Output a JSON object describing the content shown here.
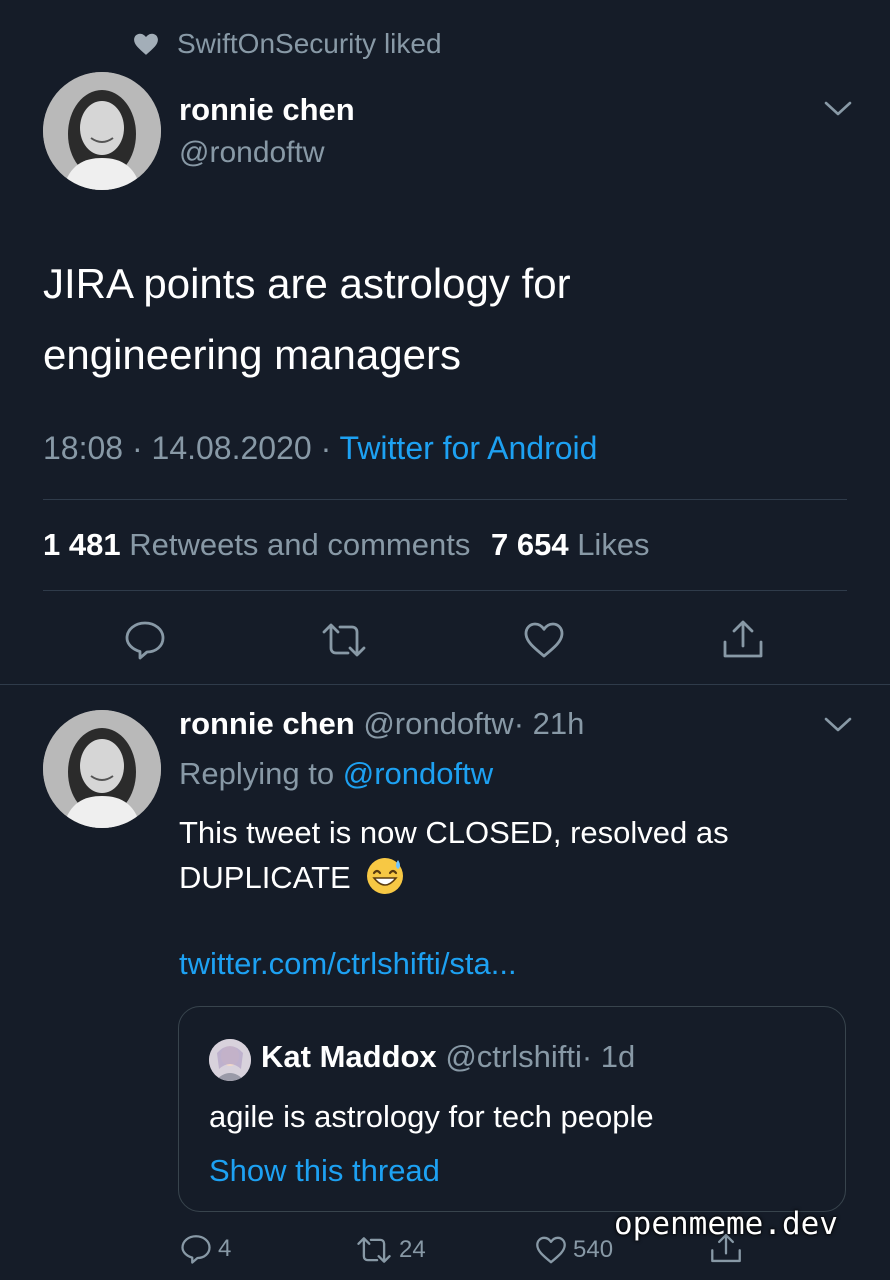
{
  "liked_banner": {
    "icon": "heart-icon",
    "text": "SwiftOnSecurity liked"
  },
  "main_tweet": {
    "author_name": "ronnie chen",
    "author_handle": "@rondoftw",
    "text_line1": "JIRA points are astrology for",
    "text_line2": "engineering managers",
    "time": "18:08",
    "sep1": "·",
    "date": "14.08.2020",
    "sep2": "·",
    "source": "Twitter for Android",
    "retweets_count": "1 481",
    "retweets_label": "Retweets and comments",
    "likes_count": "7 654",
    "likes_label": "Likes"
  },
  "reply_tweet": {
    "author_name": "ronnie chen",
    "author_handle": "@rondoftw",
    "time_ago": "· 21h",
    "replying_prefix": "Replying to",
    "replying_handle": "@rondoftw",
    "text_line1": "This tweet is now CLOSED, resolved as",
    "text_line2": "DUPLICATE",
    "emoji": "😅",
    "link": "twitter.com/ctrlshifti/sta...",
    "quote": {
      "author_name": "Kat Maddox",
      "author_handle": "@ctrlshifti",
      "time_ago": "· 1d",
      "text": "agile is astrology for tech people",
      "show_thread": "Show this thread"
    },
    "replies_count": "4",
    "retweets_count": "24",
    "likes_count": "540"
  },
  "watermark": "openmeme.dev",
  "colors": {
    "background": "#151c28",
    "accent": "#1da1f2",
    "muted": "#8899a6",
    "divider": "#2f3b4a"
  }
}
